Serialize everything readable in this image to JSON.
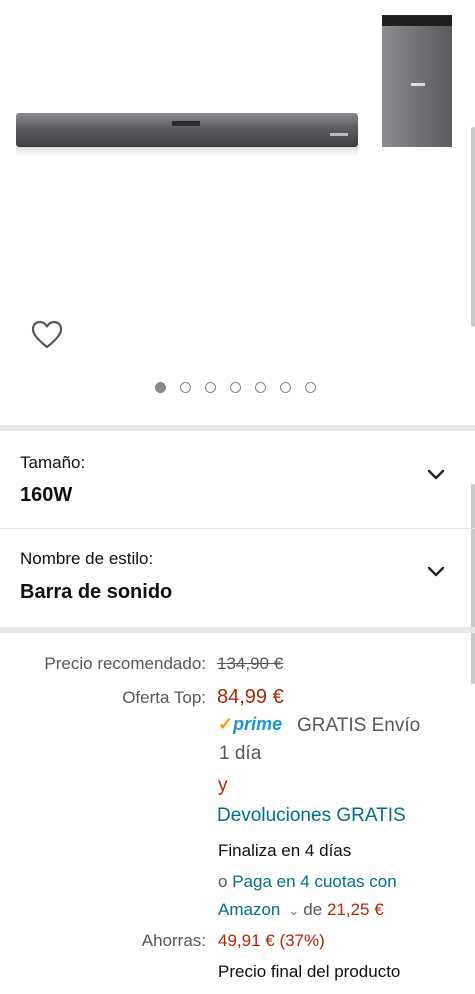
{
  "product": {
    "gallery": {
      "image_count": 7,
      "active_index": 0
    },
    "variants": [
      {
        "label": "Tamaño:",
        "value": "160W"
      },
      {
        "label": "Nombre de estilo:",
        "value": "Barra de sonido"
      }
    ],
    "pricing": {
      "list_label": "Precio recomendado:",
      "list_price": "134,90 €",
      "deal_label": "Oferta Top:",
      "deal_price": "84,99 €",
      "prime_check": "✓",
      "prime_text": "prime",
      "shipping": "GRATIS Envío",
      "shipping_time": "1 día",
      "and": "y",
      "returns": "Devoluciones GRATIS",
      "ends": "Finaliza en 4 días",
      "installments_prefix": "o",
      "installments_link": "Paga en 4 cuotas con",
      "installments_link2": "Amazon",
      "installments_of": "de",
      "installments_amount": "21,25 €",
      "savings_label": "Ahorras:",
      "savings_value": "49,91 € (37%)",
      "final_price_note": "Precio final del producto"
    }
  },
  "colors": {
    "price_red": "#b12704",
    "link_teal": "#007185",
    "prime_blue": "#1a98d5"
  }
}
